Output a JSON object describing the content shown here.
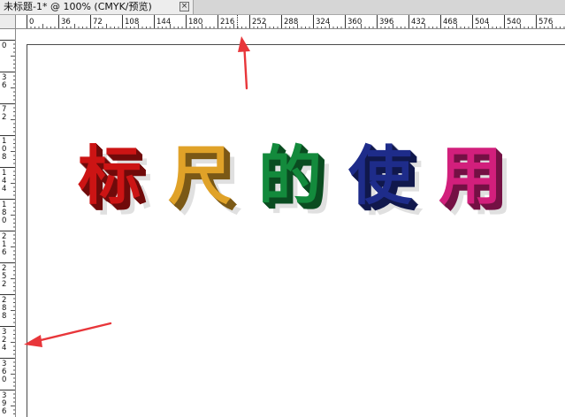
{
  "document": {
    "tab_title": "未标题-1* @ 100% (CMYK/预览)",
    "close_glyph": "×"
  },
  "rulers": {
    "horizontal_labels": [
      "0",
      "36",
      "72",
      "108",
      "144",
      "180",
      "216",
      "252",
      "288",
      "324",
      "360",
      "396",
      "432",
      "468",
      "504",
      "540",
      "576"
    ],
    "vertical_labels": [
      "0",
      "36",
      "72",
      "108",
      "144",
      "180",
      "216",
      "252",
      "288",
      "324",
      "360",
      "396"
    ]
  },
  "canvas": {
    "headline_chars": [
      {
        "char": "标",
        "color": "#cc1414"
      },
      {
        "char": "尺",
        "color": "#e0a228"
      },
      {
        "char": "的",
        "color": "#138a3c"
      },
      {
        "char": "使",
        "color": "#1e2c8a"
      },
      {
        "char": "用",
        "color": "#d21f7c"
      }
    ]
  },
  "annotations": {
    "arrow_color": "#e8363a",
    "arrow_names": [
      "horizontal-ruler-arrow",
      "vertical-ruler-arrow"
    ]
  }
}
